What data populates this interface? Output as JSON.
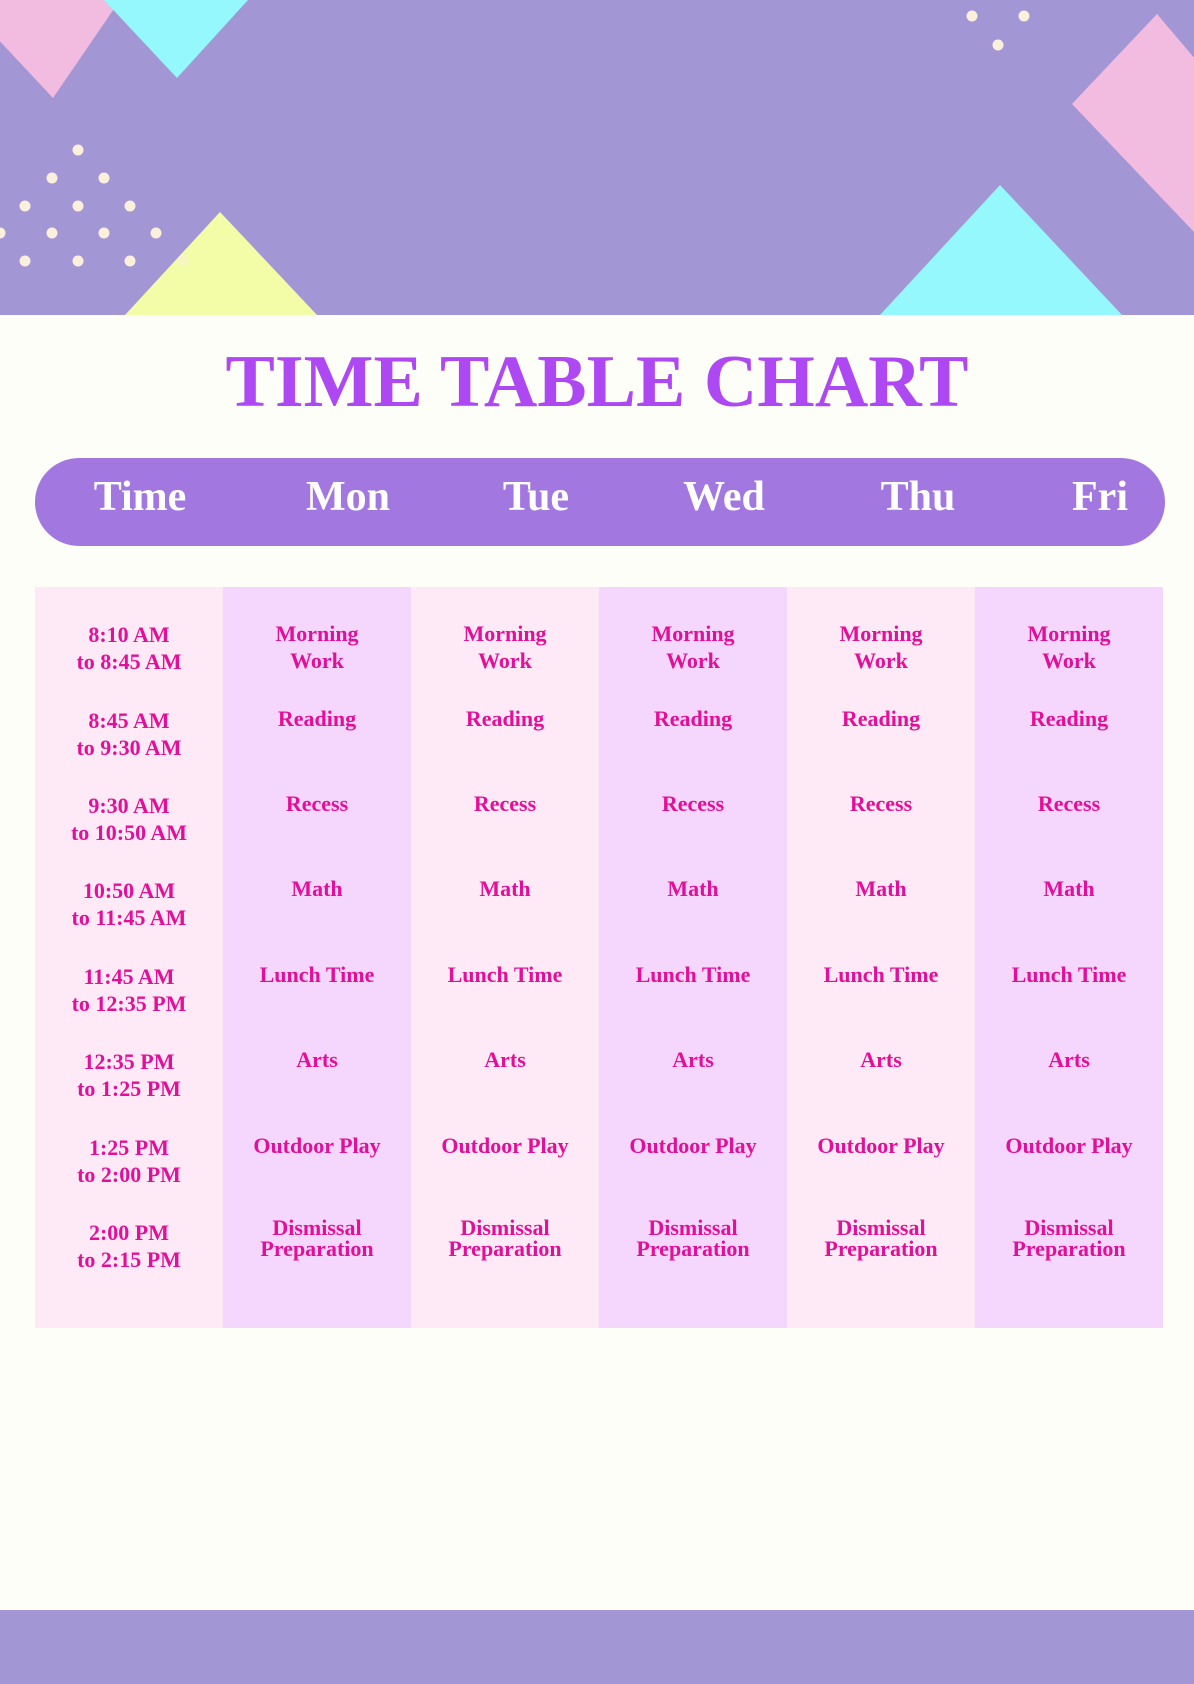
{
  "title": "TIME TABLE CHART",
  "colors": {
    "banner": "#a396d5",
    "header_pill": "#a278e0",
    "title": "#ad48f3",
    "cell_text": "#e20f99",
    "column_light": "#fdeaf6",
    "column_dark": "#f5d6fd",
    "page_background": "#fcfef7"
  },
  "header": {
    "columns": [
      "Time",
      "Mon",
      "Tue",
      "Wed",
      "Thu",
      "Fri"
    ]
  },
  "schedule": {
    "times": [
      {
        "line1": "8:10 AM",
        "line2": "to 8:45 AM"
      },
      {
        "line1": "8:45 AM",
        "line2": "to 9:30 AM"
      },
      {
        "line1": "9:30 AM",
        "line2": "to 10:50 AM"
      },
      {
        "line1": "10:50 AM",
        "line2": "to 11:45 AM"
      },
      {
        "line1": "11:45 AM",
        "line2": "to 12:35 PM"
      },
      {
        "line1": "12:35 PM",
        "line2": "to 1:25 PM"
      },
      {
        "line1": "1:25 PM",
        "line2": "to 2:00 PM"
      },
      {
        "line1": "2:00 PM",
        "line2": "to 2:15 PM"
      }
    ],
    "days": {
      "mon": [
        {
          "line1": "Morning",
          "line2": "Work"
        },
        {
          "line1": "Reading",
          "line2": ""
        },
        {
          "line1": "Recess",
          "line2": ""
        },
        {
          "line1": "Math",
          "line2": ""
        },
        {
          "line1": "Lunch Time",
          "line2": ""
        },
        {
          "line1": "Arts",
          "line2": ""
        },
        {
          "line1": "Outdoor Play",
          "line2": ""
        },
        {
          "line1": "Dismissal",
          "line2": "Preparation"
        }
      ],
      "tue": [
        {
          "line1": "Morning",
          "line2": "Work"
        },
        {
          "line1": "Reading",
          "line2": ""
        },
        {
          "line1": "Recess",
          "line2": ""
        },
        {
          "line1": "Math",
          "line2": ""
        },
        {
          "line1": "Lunch Time",
          "line2": ""
        },
        {
          "line1": "Arts",
          "line2": ""
        },
        {
          "line1": "Outdoor Play",
          "line2": ""
        },
        {
          "line1": "Dismissal",
          "line2": "Preparation"
        }
      ],
      "wed": [
        {
          "line1": "Morning",
          "line2": "Work"
        },
        {
          "line1": "Reading",
          "line2": ""
        },
        {
          "line1": "Recess",
          "line2": ""
        },
        {
          "line1": "Math",
          "line2": ""
        },
        {
          "line1": "Lunch Time",
          "line2": ""
        },
        {
          "line1": "Arts",
          "line2": ""
        },
        {
          "line1": "Outdoor Play",
          "line2": ""
        },
        {
          "line1": "Dismissal",
          "line2": "Preparation"
        }
      ],
      "thu": [
        {
          "line1": "Morning",
          "line2": "Work"
        },
        {
          "line1": "Reading",
          "line2": ""
        },
        {
          "line1": "Recess",
          "line2": ""
        },
        {
          "line1": "Math",
          "line2": ""
        },
        {
          "line1": "Lunch Time",
          "line2": ""
        },
        {
          "line1": "Arts",
          "line2": ""
        },
        {
          "line1": "Outdoor Play",
          "line2": ""
        },
        {
          "line1": "Dismissal",
          "line2": "Preparation"
        }
      ],
      "fri": [
        {
          "line1": "Morning",
          "line2": "Work"
        },
        {
          "line1": "Reading",
          "line2": ""
        },
        {
          "line1": "Recess",
          "line2": ""
        },
        {
          "line1": "Math",
          "line2": ""
        },
        {
          "line1": "Lunch Time",
          "line2": ""
        },
        {
          "line1": "Arts",
          "line2": ""
        },
        {
          "line1": "Outdoor Play",
          "line2": ""
        },
        {
          "line1": "Dismissal",
          "line2": "Preparation"
        }
      ]
    }
  }
}
